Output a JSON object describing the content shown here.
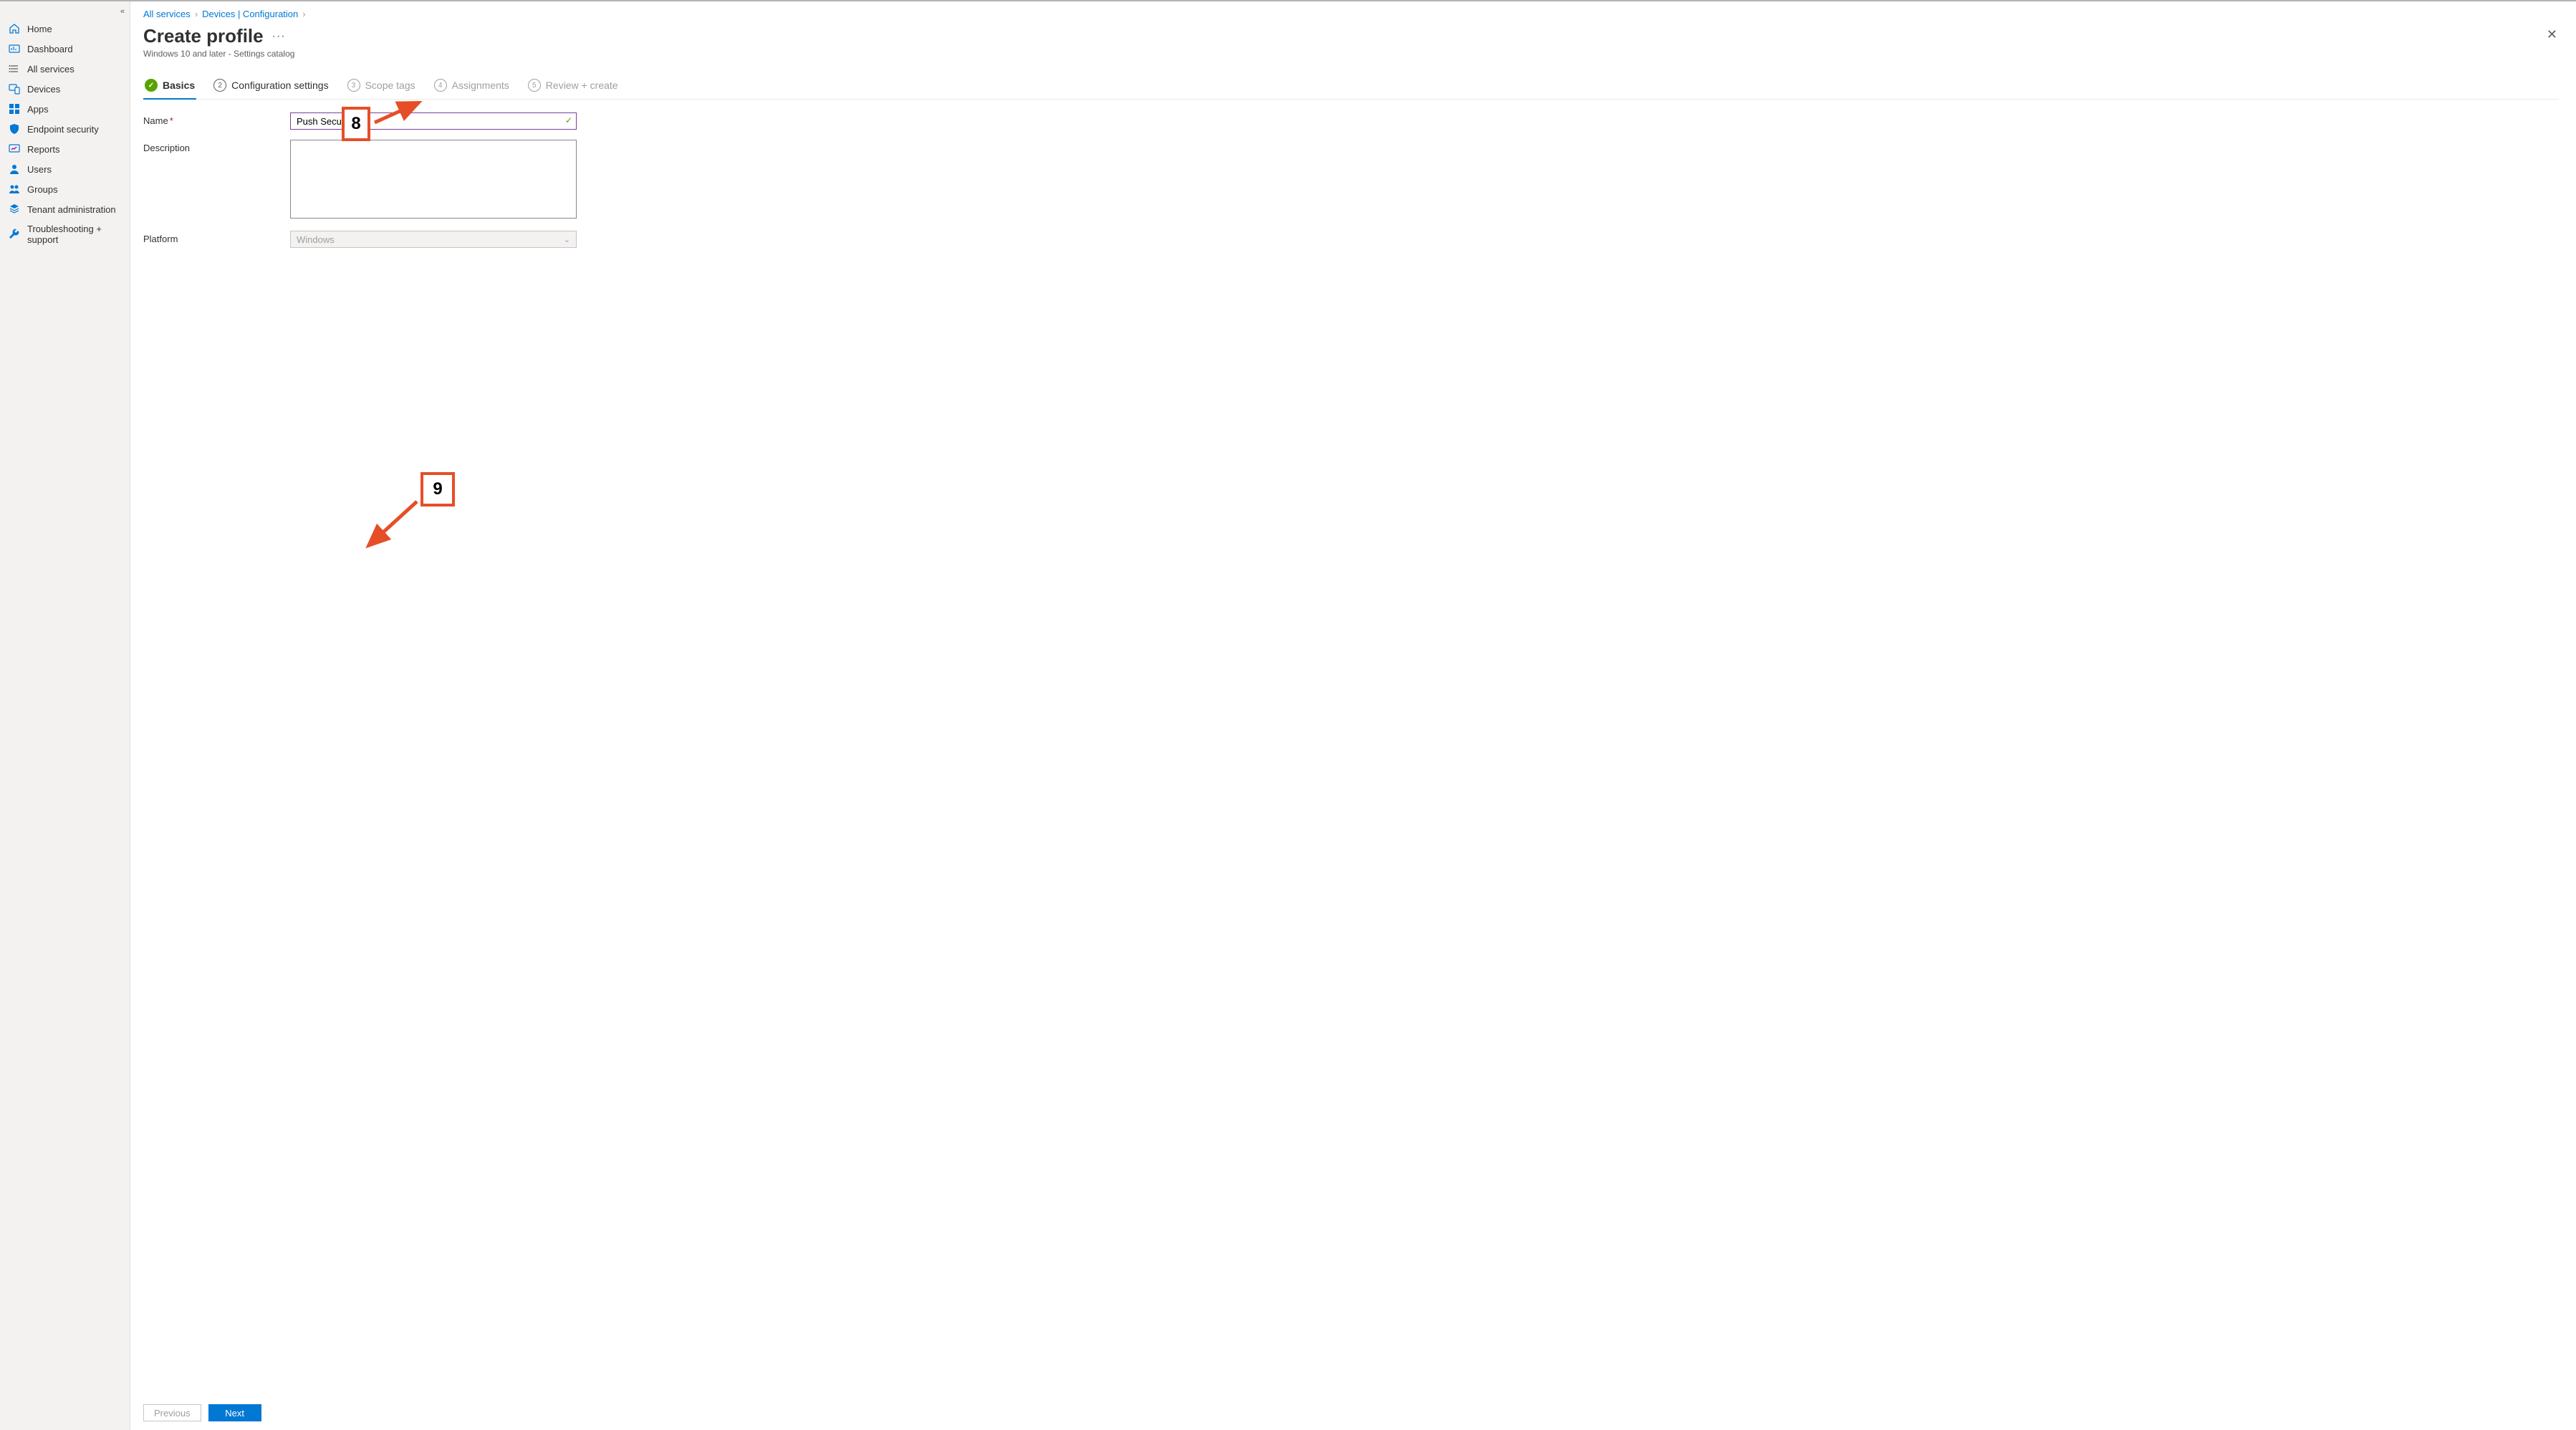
{
  "sidebar": {
    "items": [
      {
        "label": "Home",
        "icon": "home"
      },
      {
        "label": "Dashboard",
        "icon": "dashboard"
      },
      {
        "label": "All services",
        "icon": "list"
      },
      {
        "label": "Devices",
        "icon": "devices"
      },
      {
        "label": "Apps",
        "icon": "apps"
      },
      {
        "label": "Endpoint security",
        "icon": "shield"
      },
      {
        "label": "Reports",
        "icon": "reports"
      },
      {
        "label": "Users",
        "icon": "user"
      },
      {
        "label": "Groups",
        "icon": "groups"
      },
      {
        "label": "Tenant administration",
        "icon": "tenant"
      },
      {
        "label": "Troubleshooting + support",
        "icon": "wrench"
      }
    ]
  },
  "breadcrumb": {
    "items": [
      {
        "label": "All services"
      },
      {
        "label": "Devices | Configuration"
      }
    ]
  },
  "page": {
    "title": "Create profile",
    "subtitle": "Windows 10 and later - Settings catalog",
    "more": "···"
  },
  "wizard": {
    "steps": [
      {
        "num": "✓",
        "label": "Basics",
        "state": "done"
      },
      {
        "num": "2",
        "label": "Configuration settings",
        "state": "next"
      },
      {
        "num": "3",
        "label": "Scope tags",
        "state": "future"
      },
      {
        "num": "4",
        "label": "Assignments",
        "state": "future"
      },
      {
        "num": "5",
        "label": "Review + create",
        "state": "future"
      }
    ]
  },
  "form": {
    "name_label": "Name",
    "name_value": "Push Security",
    "description_label": "Description",
    "description_value": "",
    "platform_label": "Platform",
    "platform_value": "Windows"
  },
  "footer": {
    "previous": "Previous",
    "next": "Next"
  },
  "annotations": {
    "box8": "8",
    "box9": "9"
  }
}
